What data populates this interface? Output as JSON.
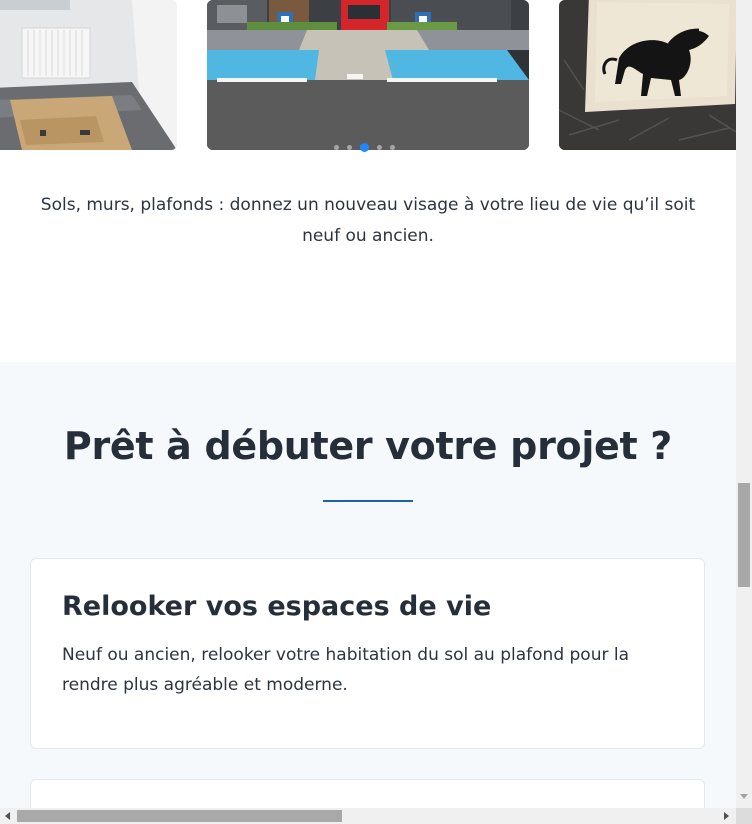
{
  "gallery": {
    "slides": [
      {
        "name": "renovated-room-photo"
      },
      {
        "name": "accessible-parking-photo"
      },
      {
        "name": "horse-painting-photo"
      }
    ],
    "active_index": 2,
    "dot_count": 5,
    "caption": "Sols, murs, plafonds : donnez un nouveau visage à votre lieu de vie qu’il soit neuf ou ancien."
  },
  "cta": {
    "title": "Prêt à débuter votre projet ?",
    "cards": [
      {
        "title": "Relooker vos espaces de vie",
        "text": "Neuf ou ancien, relooker votre habitation du sol au plafond pour la rendre plus agréable et moderne."
      }
    ]
  },
  "colors": {
    "accent": "#1f86ff",
    "rule": "#1f5fad",
    "section_bg": "#f5f9fc",
    "heading": "#252e39",
    "parking_blue": "#4fb7e2",
    "door_red": "#d4262a"
  }
}
